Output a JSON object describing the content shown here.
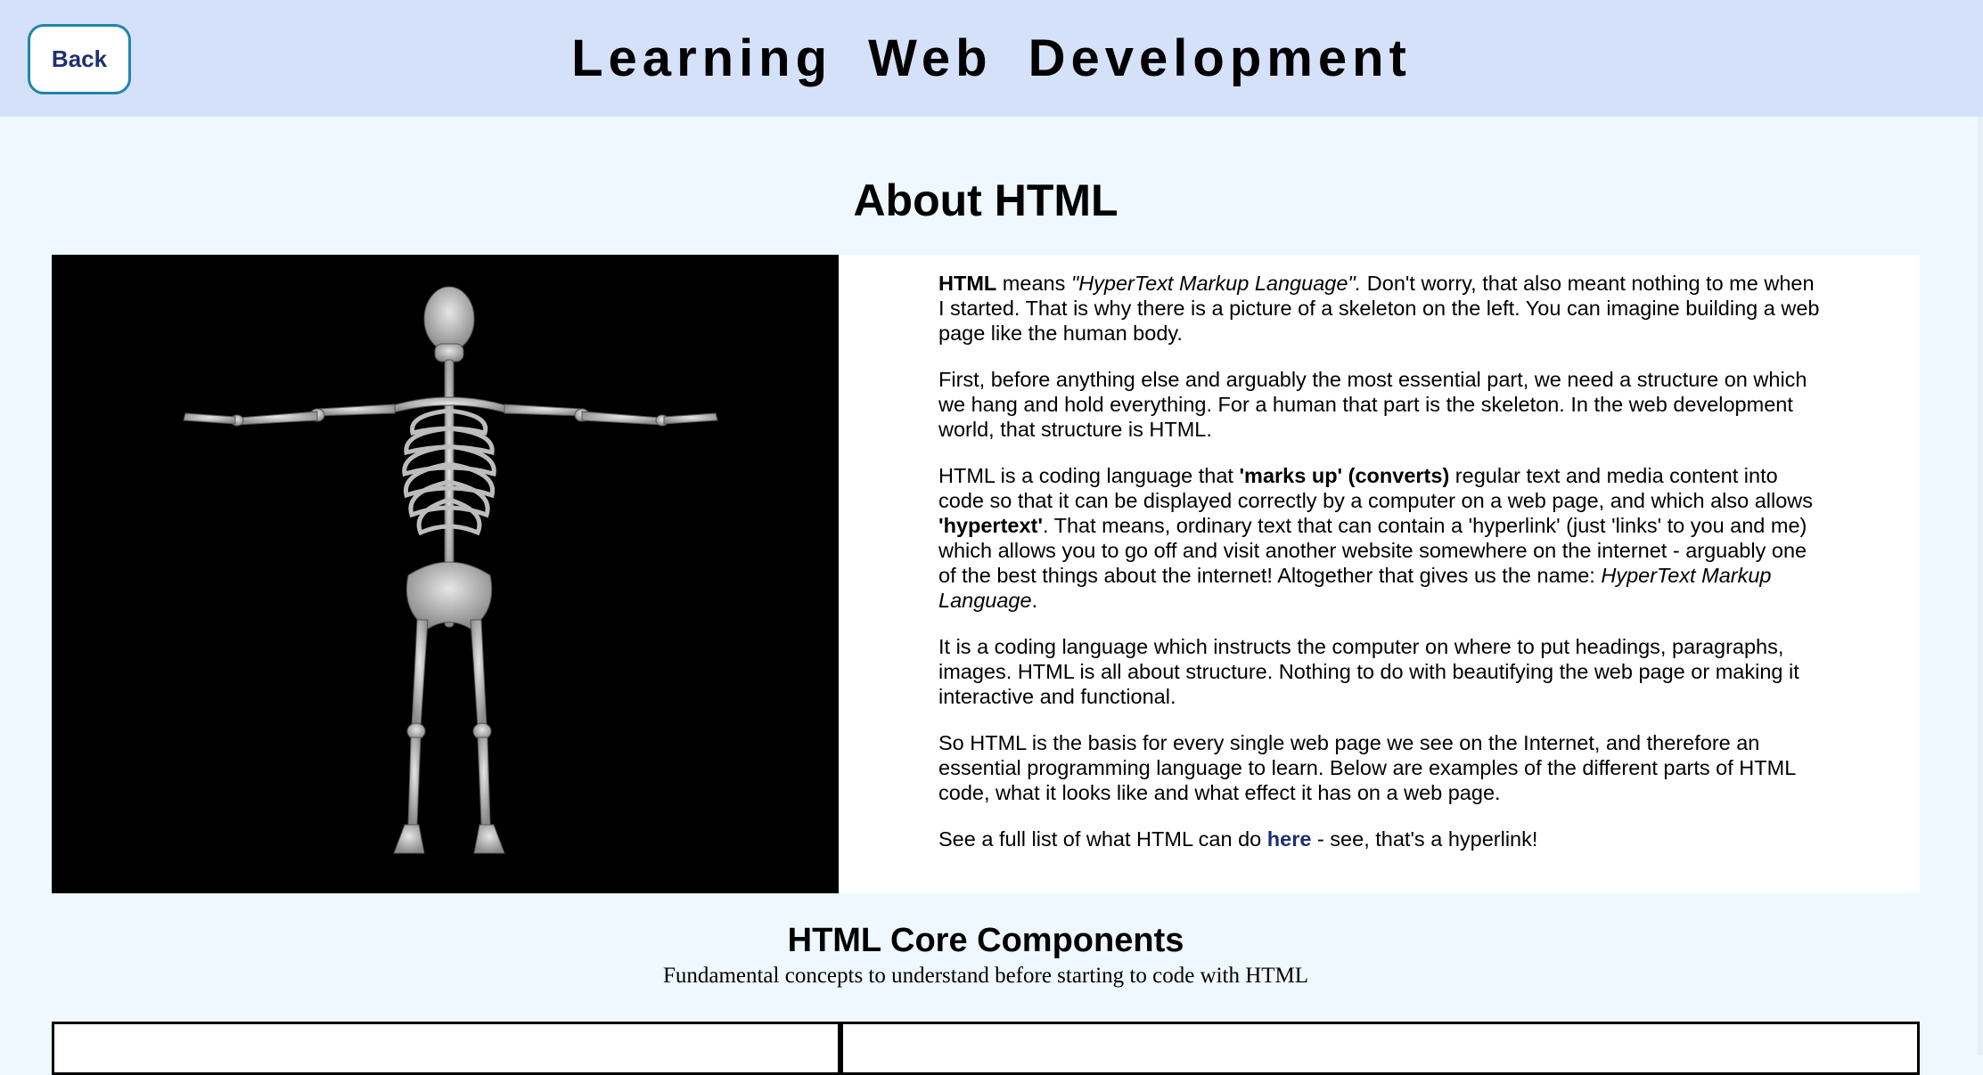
{
  "header": {
    "back_label": "Back",
    "site_title": "Learning Web Development"
  },
  "about": {
    "title": "About HTML",
    "image_subject": "human skeleton",
    "p1": {
      "strong": "HTML",
      "t1": " means ",
      "em": "\"HyperText Markup Language\".",
      "t2": " Don't worry, that also meant nothing to me when I started. That is why there is a picture of a skeleton on the left. You can imagine building a web page like the human body."
    },
    "p2": "First, before anything else and arguably the most essential part, we need a structure on which we hang and hold everything. For a human that part is the skeleton. In the web development world, that structure is HTML.",
    "p3": {
      "t1": "HTML is a coding language that ",
      "strong1": "'marks up' (converts)",
      "t2": " regular text and media content into code so that it can be displayed correctly by a computer on a web page, and which also allows ",
      "strong2": "'hypertext'",
      "t3": ". That means, ordinary text that can contain a 'hyperlink' (just 'links' to you and me) which allows you to go off and visit another website somewhere on the internet - arguably one of the best things about the internet! Altogether that gives us the name: ",
      "em": "HyperText Markup Language",
      "t4": "."
    },
    "p4": "It is a coding language which instructs the computer on where to put headings, paragraphs, images. HTML is all about structure. Nothing to do with beautifying the web page or making it interactive and functional.",
    "p5": "So HTML is the basis for every single web page we see on the Internet, and therefore an essential programming language to learn. Below are examples of the different parts of HTML code, what it looks like and what effect it has on a web page.",
    "p6": {
      "t1": "See a full list of what HTML can do ",
      "link": "here",
      "t2": " - see, that's a hyperlink!"
    }
  },
  "core": {
    "title": "HTML Core Components",
    "subtitle": "Fundamental concepts to understand before starting to code with HTML"
  },
  "colors": {
    "header_bg": "#d5e1f9",
    "page_bg": "#eff7ff",
    "link": "#1d2f73",
    "button_border": "#1f86ad"
  }
}
